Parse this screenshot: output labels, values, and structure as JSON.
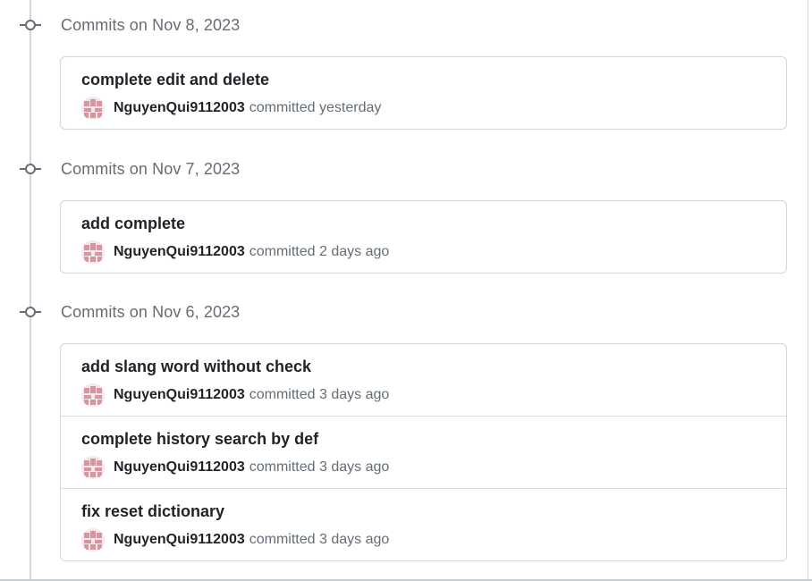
{
  "colors": {
    "timeline": "#d0d7de",
    "muted_text": "#656d76",
    "primary_text": "#1f2328",
    "border": "#d0d7de",
    "avatar_pink": "#d9949e"
  },
  "groups": [
    {
      "title": "Commits on Nov 8, 2023",
      "commits": [
        {
          "message": "complete edit and delete",
          "author": "NguyenQui9112003",
          "meta": "committed yesterday"
        }
      ]
    },
    {
      "title": "Commits on Nov 7, 2023",
      "commits": [
        {
          "message": "add complete",
          "author": "NguyenQui9112003",
          "meta": "committed 2 days ago"
        }
      ]
    },
    {
      "title": "Commits on Nov 6, 2023",
      "commits": [
        {
          "message": "add slang word without check",
          "author": "NguyenQui9112003",
          "meta": "committed 3 days ago"
        },
        {
          "message": "complete history search by def",
          "author": "NguyenQui9112003",
          "meta": "committed 3 days ago"
        },
        {
          "message": "fix reset dictionary",
          "author": "NguyenQui9112003",
          "meta": "committed 3 days ago"
        }
      ]
    }
  ],
  "icons": {
    "commit_node": "git-commit-icon",
    "avatar": "identicon-avatar"
  }
}
